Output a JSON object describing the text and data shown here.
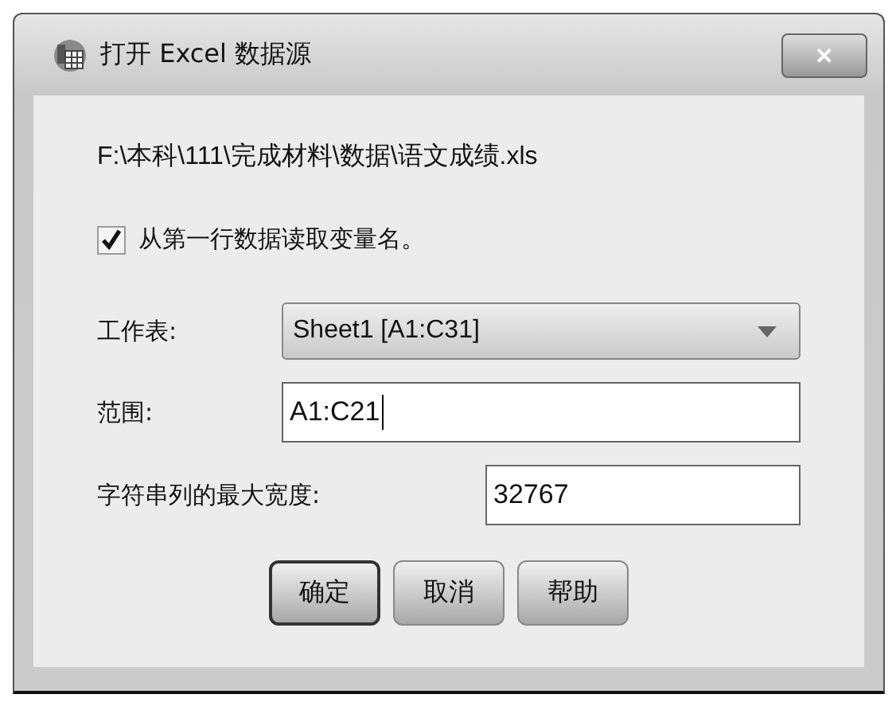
{
  "window": {
    "title": "打开 Excel 数据源",
    "close": "✕"
  },
  "file_path": "F:\\本科\\111\\完成材料\\数据\\语文成绩.xls",
  "header_option": {
    "label": "从第一行数据读取变量名。",
    "checked": true
  },
  "worksheet": {
    "label": "工作表:",
    "value": "Sheet1 [A1:C31]"
  },
  "range": {
    "label": "范围:",
    "value": "A1:C21"
  },
  "max_string_width": {
    "label": "字符串列的最大宽度:",
    "value": "32767"
  },
  "buttons": [
    {
      "label": "确定",
      "default": true
    },
    {
      "label": "取消",
      "default": false
    },
    {
      "label": "帮助",
      "default": false
    }
  ]
}
